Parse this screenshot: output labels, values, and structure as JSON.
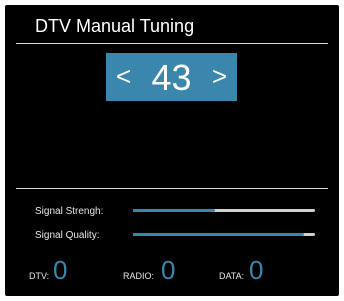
{
  "window": {
    "title": "DTV Manual Tuning"
  },
  "channel": {
    "prev_icon": "chevron-left-icon",
    "next_icon": "chevron-right-icon",
    "number": "43",
    "prev_glyph": "<",
    "next_glyph": ">"
  },
  "signal": {
    "strength_label": "Signal Strengh:",
    "strength_level": 0.45,
    "quality_label": "Signal Quality:",
    "quality_level": 0.94
  },
  "counts": {
    "dtv_label": "DTV:",
    "dtv_value": "0",
    "radio_label": "RADIO:",
    "radio_value": "0",
    "data_label": "DATA:",
    "data_value": "0"
  },
  "colors": {
    "accent": "#3a86ad",
    "background": "#000000",
    "bar_track": "#cfcfcf"
  }
}
